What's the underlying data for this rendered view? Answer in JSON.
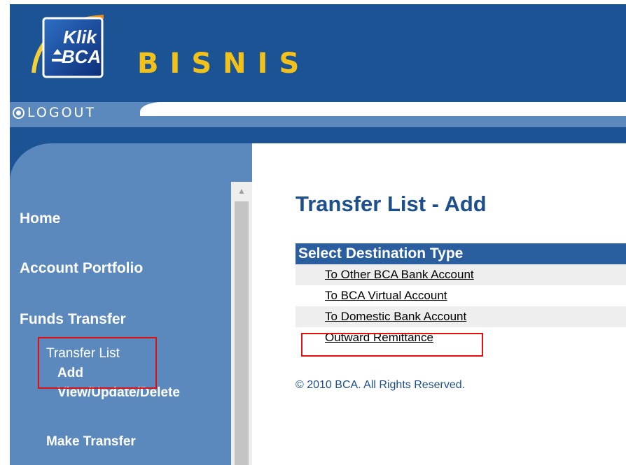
{
  "header": {
    "logo_line1": "Klik",
    "logo_line2": "BCA",
    "brand": "BISNIS",
    "logout_label": "LOGOUT"
  },
  "sidebar": {
    "items": [
      {
        "label": "Home"
      },
      {
        "label": "Account Portfolio"
      },
      {
        "label": "Funds Transfer"
      },
      {
        "label": "Transfer List"
      },
      {
        "label": "Add"
      },
      {
        "label": "View/Update/Delete"
      },
      {
        "label": "Make Transfer"
      }
    ]
  },
  "main": {
    "title": "Transfer List - Add",
    "table_header": "Select Destination Type",
    "options": [
      {
        "label": "To Other BCA Bank Account"
      },
      {
        "label": "To BCA Virtual Account"
      },
      {
        "label": "To Domestic Bank Account"
      },
      {
        "label": "Outward Remittance"
      }
    ],
    "footer": "© 2010 BCA. All Rights Reserved."
  },
  "colors": {
    "header_blue": "#1b5394",
    "sidebar_blue": "#5b89be",
    "brand_yellow": "#f2c21a",
    "title_blue": "#1c4f8c",
    "highlight_red": "#e01010"
  }
}
